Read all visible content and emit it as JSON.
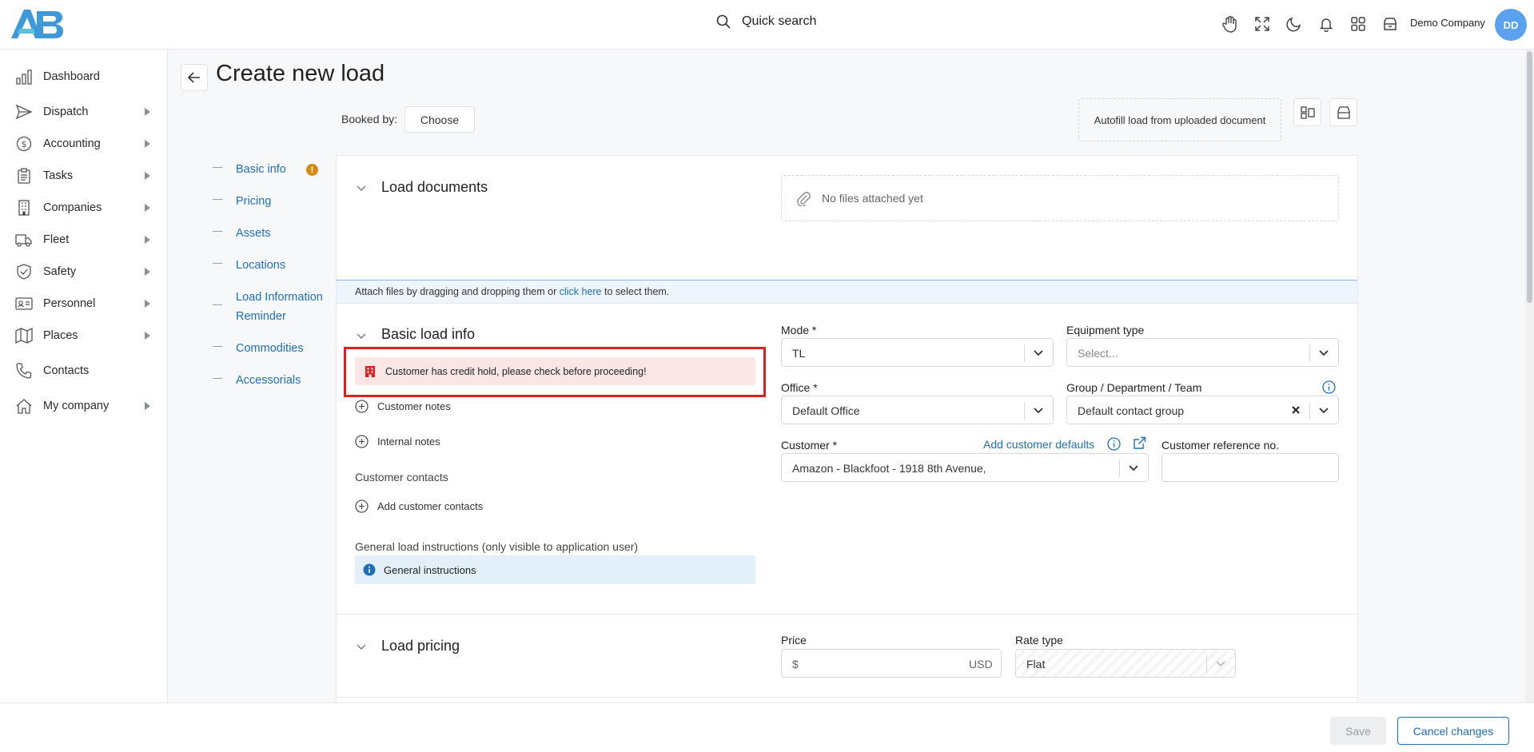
{
  "header": {
    "search_label": "Quick search",
    "company": "Demo Company",
    "avatar_initials": "DD",
    "icons": [
      "hand-icon",
      "fullscreen-icon",
      "moon-icon",
      "bell-icon",
      "apps-grid-icon",
      "archive-icon"
    ]
  },
  "sidebar": {
    "items": [
      {
        "label": "Dashboard",
        "icon": "chart-bars-icon",
        "has_submenu": false
      },
      {
        "label": "Dispatch",
        "icon": "send-icon",
        "has_submenu": true
      },
      {
        "label": "Accounting",
        "icon": "dollar-icon",
        "has_submenu": true
      },
      {
        "label": "Tasks",
        "icon": "clipboard-icon",
        "has_submenu": true
      },
      {
        "label": "Companies",
        "icon": "building-icon",
        "has_submenu": true
      },
      {
        "label": "Fleet",
        "icon": "truck-icon",
        "has_submenu": true
      },
      {
        "label": "Safety",
        "icon": "shield-icon",
        "has_submenu": true
      },
      {
        "label": "Personnel",
        "icon": "id-card-icon",
        "has_submenu": true
      },
      {
        "label": "Places",
        "icon": "map-icon",
        "has_submenu": true
      },
      {
        "label": "Contacts",
        "icon": "phone-icon",
        "has_submenu": false
      },
      {
        "label": "My company",
        "icon": "home-icon",
        "has_submenu": true
      }
    ]
  },
  "page": {
    "title": "Create new load",
    "booked_by_label": "Booked by:",
    "choose_label": "Choose",
    "autofill_label": "Autofill load from uploaded document"
  },
  "section_nav": {
    "items": [
      "Basic info",
      "Pricing",
      "Assets",
      "Locations",
      "Load Information Reminder",
      "Commodities",
      "Accessorials"
    ],
    "warning_badge": "!"
  },
  "documents": {
    "title": "Load documents",
    "empty_text": "No files attached yet",
    "attach_prefix": "Attach files by dragging and dropping them or ",
    "attach_link": "click here",
    "attach_suffix": " to select them."
  },
  "basic_info": {
    "title": "Basic load info",
    "alert": "Customer has credit hold, please check before proceeding!",
    "customer_notes": "Customer notes",
    "internal_notes": "Internal notes",
    "customer_contacts_label": "Customer contacts",
    "add_customer_contacts": "Add customer contacts",
    "general_instructions_label": "General load instructions (only visible to application user)",
    "general_instructions": "General instructions",
    "mode_label": "Mode *",
    "mode_value": "TL",
    "equipment_label": "Equipment type",
    "equipment_placeholder": "Select...",
    "office_label": "Office *",
    "office_value": "Default Office",
    "group_label": "Group / Department / Team",
    "group_value": "Default contact group",
    "customer_label": "Customer *",
    "add_customer_defaults": "Add customer defaults",
    "customer_value": "Amazon - Blackfoot - 1918 8th Avenue,",
    "customer_ref_label": "Customer reference no.",
    "customer_ref_value": ""
  },
  "pricing": {
    "title": "Load pricing",
    "price_label": "Price",
    "price_prefix": "$",
    "price_currency": "USD",
    "rate_type_label": "Rate type",
    "rate_type_value": "Flat"
  },
  "footer": {
    "save": "Save",
    "cancel": "Cancel changes"
  },
  "colors": {
    "accent": "#1f6fb8",
    "alert_border": "#d92323",
    "alert_bg": "#fbe6e6",
    "warning": "#d58a12",
    "avatar": "#5aa1f0"
  }
}
